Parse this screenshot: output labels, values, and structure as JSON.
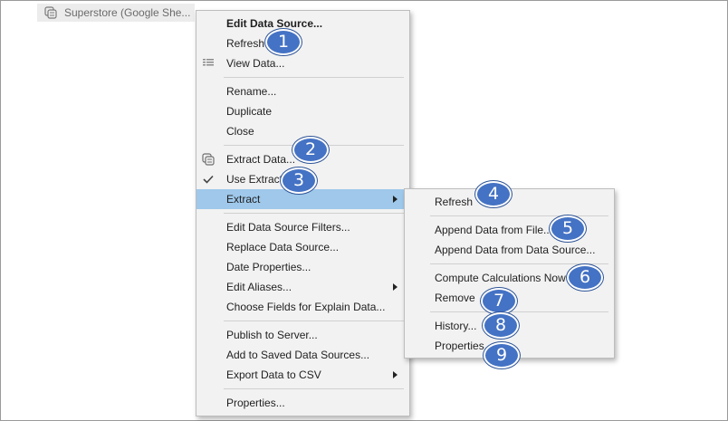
{
  "datasource_tab": {
    "label": "Superstore (Google She..."
  },
  "main_menu": {
    "edit_data_source": "Edit Data Source...",
    "refresh": "Refresh",
    "view_data": "View Data...",
    "rename": "Rename...",
    "duplicate": "Duplicate",
    "close": "Close",
    "extract_data": "Extract Data...",
    "use_extract": "Use Extract",
    "extract": "Extract",
    "edit_filters": "Edit Data Source Filters...",
    "replace_data_source": "Replace Data Source...",
    "date_properties": "Date Properties...",
    "edit_aliases": "Edit Aliases...",
    "choose_fields": "Choose Fields for Explain Data...",
    "publish": "Publish to Server...",
    "add_saved": "Add to Saved Data Sources...",
    "export_csv": "Export Data to CSV",
    "properties": "Properties..."
  },
  "extract_submenu": {
    "refresh": "Refresh",
    "append_file": "Append Data from File...",
    "append_source": "Append Data from Data Source...",
    "compute_calcs": "Compute Calculations Now",
    "remove": "Remove",
    "history": "History...",
    "properties": "Properties..."
  },
  "callouts": [
    "1",
    "2",
    "3",
    "4",
    "5",
    "6",
    "7",
    "8",
    "9"
  ],
  "colors": {
    "menu_bg": "#f2f2f2",
    "highlight": "#9fc8ea",
    "callout": "#4472c4"
  },
  "icons": {
    "datasource": "datasource-icon",
    "view_data": "grid-icon",
    "extract": "extract-icon",
    "checked": "checkmark-icon",
    "submenu": "chevron-right-icon"
  }
}
